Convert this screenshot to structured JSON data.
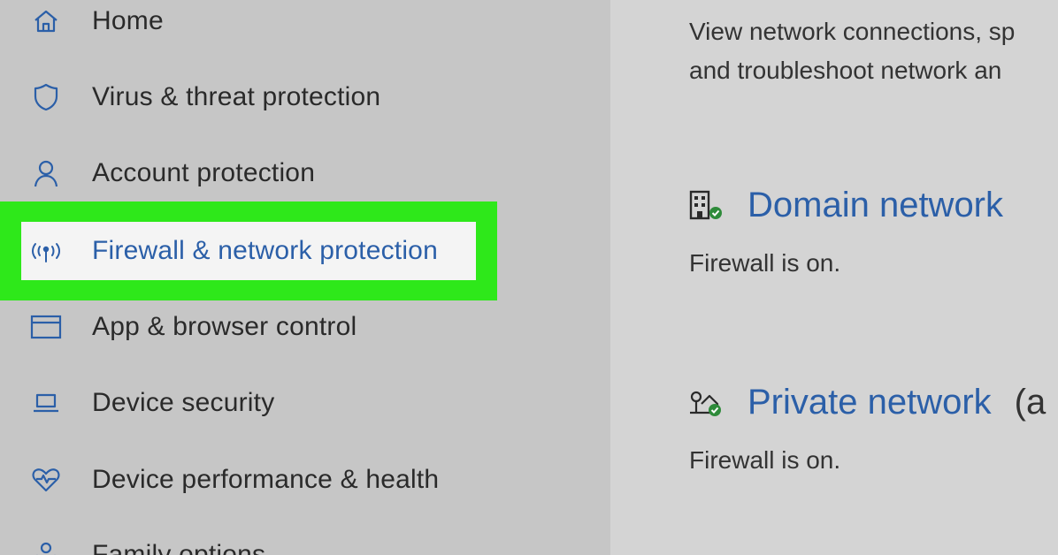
{
  "sidebar": {
    "items": [
      {
        "label": "Home",
        "icon": "home-icon"
      },
      {
        "label": "Virus & threat protection",
        "icon": "shield-icon"
      },
      {
        "label": "Account protection",
        "icon": "person-icon"
      },
      {
        "label": "Firewall & network protection",
        "icon": "wireless-antenna-icon",
        "active": true
      },
      {
        "label": "App & browser control",
        "icon": "app-window-icon"
      },
      {
        "label": "Device security",
        "icon": "laptop-icon"
      },
      {
        "label": "Device performance & health",
        "icon": "heart-icon"
      },
      {
        "label": "Family options",
        "icon": "family-icon"
      }
    ]
  },
  "main": {
    "intro_line1": "View network connections, sp",
    "intro_line2": "and troubleshoot network an",
    "networks": [
      {
        "title": "Domain network",
        "suffix": "",
        "status": "Firewall is on.",
        "icon": "domain-network-icon"
      },
      {
        "title": "Private network",
        "suffix": "(a",
        "status": "Firewall is on.",
        "icon": "private-network-icon"
      }
    ]
  },
  "colors": {
    "highlight": "#2ee81a",
    "link_blue": "#2b5fa8",
    "status_green": "#2e8b3a"
  }
}
